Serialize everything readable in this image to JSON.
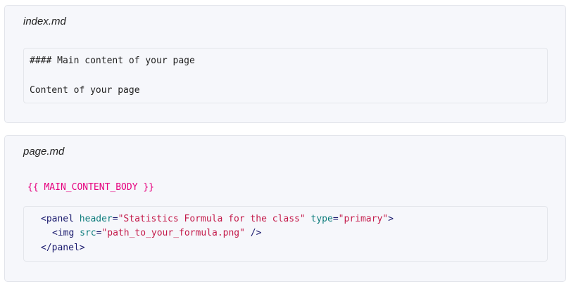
{
  "colors": {
    "tag": "#1a1a6e",
    "attribute": "#0f7d7d",
    "string": "#c41a4a",
    "placeholder": "#e6007e"
  },
  "index_card": {
    "filename": "index.md",
    "lines": [
      "#### Main content of your page",
      "Content of your page"
    ]
  },
  "page_card": {
    "filename": "page.md",
    "placeholder": "{{ MAIN_CONTENT_BODY }}",
    "code": {
      "line1": {
        "open": "<panel",
        "attr1": "header",
        "val1": "\"Statistics Formula for the class\"",
        "attr2": "type",
        "val2": "\"primary\"",
        "close": ">"
      },
      "line2": {
        "open": "<img",
        "attr1": "src",
        "val1": "\"path_to_your_formula.png\"",
        "close": " />"
      },
      "line3": {
        "text": "</panel>"
      }
    }
  }
}
